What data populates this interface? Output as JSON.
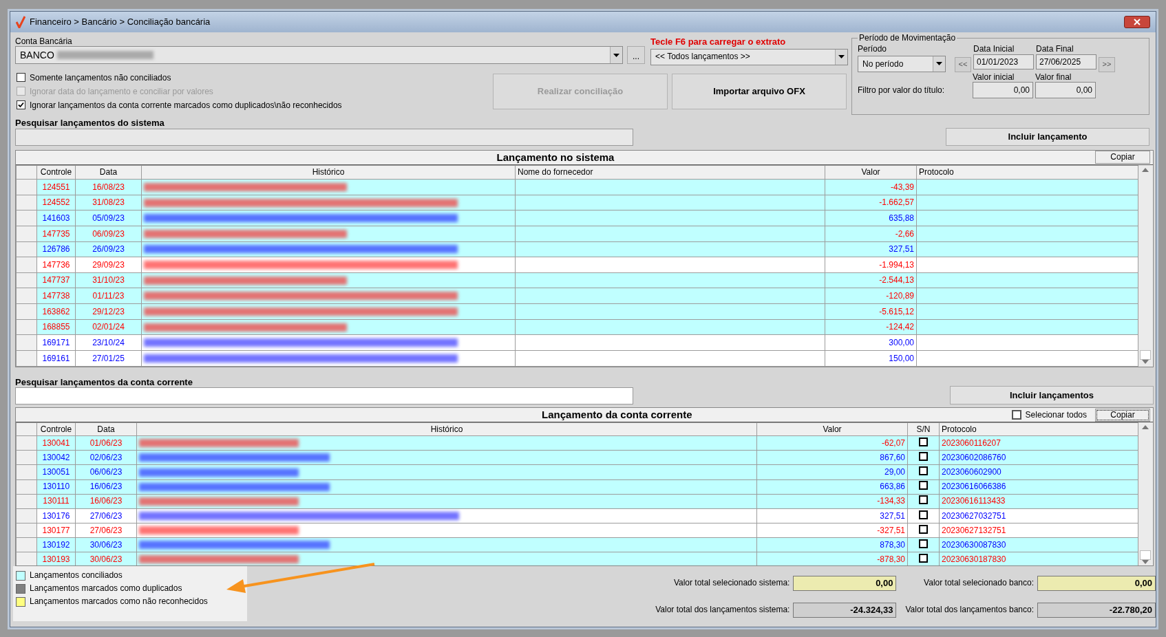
{
  "window": {
    "title": "Financeiro > Bancário > Conciliação bancária"
  },
  "conta_bancaria": {
    "label": "Conta Bancária",
    "value": "BANCO",
    "more": "..."
  },
  "extrato": {
    "hint": "Tecle F6 para carregar o extrato",
    "value": "<< Todos lançamentos >>"
  },
  "options": [
    {
      "label": "Somente lançamentos não conciliados",
      "checked": false,
      "disabled": false
    },
    {
      "label": "Ignorar data do lançamento e conciliar por valores",
      "checked": false,
      "disabled": true
    },
    {
      "label": "Ignorar lançamentos da conta corrente marcados como duplicados\\não reconhecidos",
      "checked": true,
      "disabled": false
    }
  ],
  "buttons": [
    {
      "label": "Realizar conciliação",
      "disabled": true
    },
    {
      "label": "Importar arquivo OFX",
      "disabled": false
    }
  ],
  "periodo": {
    "title": "Período de Movimentação",
    "periodo_label": "Período",
    "periodo_value": "No período",
    "data_inicial_label": "Data Inicial",
    "data_inicial": "01/01/2023",
    "data_final_label": "Data Final",
    "data_final": "27/06/2025",
    "prev": "<<",
    "next": ">>",
    "filtro_label": "Filtro por valor do título:",
    "valor_inicial_label": "Valor inicial",
    "valor_inicial": "0,00",
    "valor_final_label": "Valor final",
    "valor_final": "0,00"
  },
  "system_search": {
    "label": "Pesquisar lançamentos do sistema",
    "action": "Incluir lançamento"
  },
  "system_table": {
    "title": "Lançamento no sistema",
    "copy": "Copiar",
    "columns": [
      "Controle",
      "Data",
      "Histórico",
      "Nome do fornecedor",
      "Valor",
      "Protocolo"
    ],
    "rows": [
      {
        "controle": "124551",
        "data": "16/08/23",
        "valor": "-43,39",
        "color": "#ff0000",
        "conciliado": true
      },
      {
        "controle": "124552",
        "data": "31/08/23",
        "valor": "-1.662,57",
        "color": "#ff0000",
        "conciliado": true
      },
      {
        "controle": "141603",
        "data": "05/09/23",
        "valor": "635,88",
        "color": "#0000ff",
        "conciliado": true
      },
      {
        "controle": "147735",
        "data": "06/09/23",
        "valor": "-2,66",
        "color": "#ff0000",
        "conciliado": true
      },
      {
        "controle": "126786",
        "data": "26/09/23",
        "valor": "327,51",
        "color": "#0000ff",
        "conciliado": true
      },
      {
        "controle": "147736",
        "data": "29/09/23",
        "valor": "-1.994,13",
        "color": "#ff0000",
        "conciliado": false
      },
      {
        "controle": "147737",
        "data": "31/10/23",
        "valor": "-2.544,13",
        "color": "#ff0000",
        "conciliado": true
      },
      {
        "controle": "147738",
        "data": "01/11/23",
        "valor": "-120,89",
        "color": "#ff0000",
        "conciliado": true
      },
      {
        "controle": "163862",
        "data": "29/12/23",
        "valor": "-5.615,12",
        "color": "#ff0000",
        "conciliado": true
      },
      {
        "controle": "168855",
        "data": "02/01/24",
        "valor": "-124,42",
        "color": "#ff0000",
        "conciliado": true
      },
      {
        "controle": "169171",
        "data": "23/10/24",
        "valor": "300,00",
        "color": "#0000ff",
        "conciliado": false
      },
      {
        "controle": "169161",
        "data": "27/01/25",
        "valor": "150,00",
        "color": "#0000ff",
        "conciliado": false
      }
    ]
  },
  "bank_search": {
    "label": "Pesquisar lançamentos da conta corrente",
    "action": "Incluir lançamentos"
  },
  "bank_table": {
    "title": "Lançamento da conta corrente",
    "select_all": {
      "label": "Selecionar todos",
      "checked": false
    },
    "copy": "Copiar",
    "columns": [
      "Controle",
      "Data",
      "Histórico",
      "Valor",
      "S/N",
      "Protocolo"
    ],
    "rows": [
      {
        "controle": "130041",
        "data": "01/06/23",
        "valor": "-62,07",
        "protocolo": "2023060116207",
        "checked": false,
        "color": "#ff0000",
        "conciliado": true
      },
      {
        "controle": "130042",
        "data": "02/06/23",
        "valor": "867,60",
        "protocolo": "20230602086760",
        "checked": false,
        "color": "#0000ff",
        "conciliado": true
      },
      {
        "controle": "130051",
        "data": "06/06/23",
        "valor": "29,00",
        "protocolo": "2023060602900",
        "checked": false,
        "color": "#0000ff",
        "conciliado": true
      },
      {
        "controle": "130110",
        "data": "16/06/23",
        "valor": "663,86",
        "protocolo": "20230616066386",
        "checked": false,
        "color": "#0000ff",
        "conciliado": true
      },
      {
        "controle": "130111",
        "data": "16/06/23",
        "valor": "-134,33",
        "protocolo": "20230616113433",
        "checked": false,
        "color": "#ff0000",
        "conciliado": true
      },
      {
        "controle": "130176",
        "data": "27/06/23",
        "valor": "327,51",
        "protocolo": "20230627032751",
        "checked": false,
        "color": "#0000ff",
        "conciliado": false
      },
      {
        "controle": "130177",
        "data": "27/06/23",
        "valor": "-327,51",
        "protocolo": "20230627132751",
        "checked": false,
        "color": "#ff0000",
        "conciliado": false
      },
      {
        "controle": "130192",
        "data": "30/06/23",
        "valor": "878,30",
        "protocolo": "20230630087830",
        "checked": false,
        "color": "#0000ff",
        "conciliado": true
      },
      {
        "controle": "130193",
        "data": "30/06/23",
        "valor": "-878,30",
        "protocolo": "20230630187830",
        "checked": false,
        "color": "#ff0000",
        "conciliado": true
      }
    ]
  },
  "legend": [
    {
      "label": "Lançamentos conciliados",
      "color": "#c0ffff"
    },
    {
      "label": "Lançamentos marcados como duplicados",
      "color": "#808080"
    },
    {
      "label": "Lançamentos marcados como não reconhecidos",
      "color": "#ffff80"
    }
  ],
  "totals": [
    {
      "label": "Valor total selecionado sistema:",
      "value": "0,00",
      "kind": "selected"
    },
    {
      "label": "Valor total selecionado banco:",
      "value": "0,00",
      "kind": "selected"
    },
    {
      "label": "Valor total dos lançamentos sistema:",
      "value": "-24.324,33",
      "kind": "total"
    },
    {
      "label": "Valor total dos lançamentos banco:",
      "value": "-22.780,20",
      "kind": "total"
    }
  ]
}
